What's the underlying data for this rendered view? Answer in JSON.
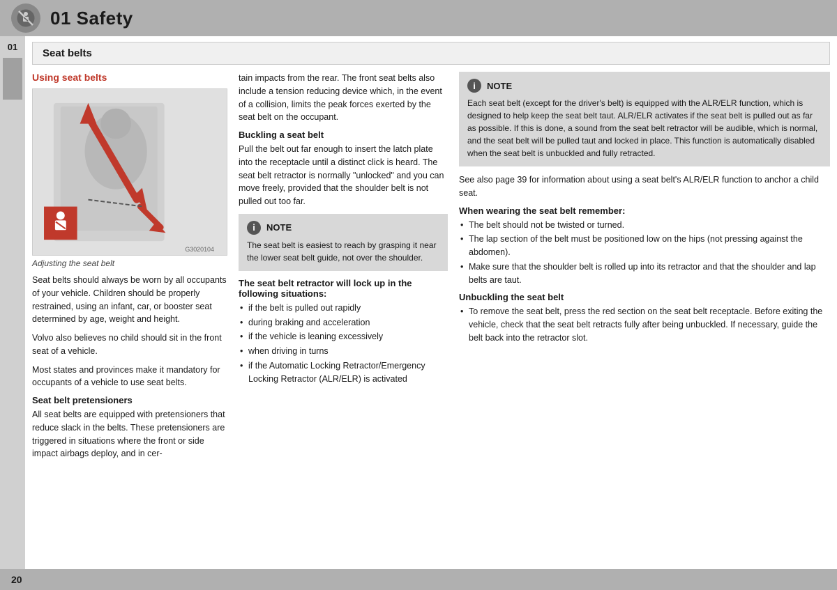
{
  "header": {
    "title": "01 Safety",
    "icon_label": "no-belt-icon"
  },
  "sidebar": {
    "number": "01"
  },
  "section": {
    "title": "Seat belts"
  },
  "left_column": {
    "section_title": "Using seat belts",
    "image_caption": "Adjusting the seat belt",
    "diagram_number": "G3020104",
    "para1": "Seat belts should always be worn by all occupants of your vehicle. Children should be properly restrained, using an infant, car, or booster seat determined by age, weight and height.",
    "para2": "Volvo also believes no child should sit in the front seat of a vehicle.",
    "para3": "Most states and provinces make it mandatory for occupants of a vehicle to use seat belts.",
    "pretensioners_title": "Seat belt pretensioners",
    "pretensioners_text": "All seat belts are equipped with pretensioners that reduce slack in the belts. These pretensioners are triggered in situations where the front or side impact airbags deploy, and in cer-"
  },
  "mid_column": {
    "continued_text": "tain impacts from the rear. The front seat belts also include a tension reducing device which, in the event of a collision, limits the peak forces exerted by the seat belt on the occupant.",
    "buckling_title": "Buckling a seat belt",
    "buckling_text": "Pull the belt out far enough to insert the latch plate into the receptacle until a distinct click is heard. The seat belt retractor is normally \"unlocked\" and you can move freely, provided that the shoulder belt is not pulled out too far.",
    "note_label": "NOTE",
    "note_text": "The seat belt is easiest to reach by grasping it near the lower seat belt guide, not over the shoulder.",
    "retractor_title": "The seat belt retractor will lock up in the following situations:",
    "retractor_bullets": [
      "if the belt is pulled out rapidly",
      "during braking and acceleration",
      "if the vehicle is leaning excessively",
      "when driving in turns",
      "if the Automatic Locking Retractor/Emergency Locking Retractor (ALR/ELR) is activated"
    ]
  },
  "right_column": {
    "note_label": "NOTE",
    "note_text": "Each seat belt (except for the driver's belt) is equipped with the ALR/ELR function, which is designed to help keep the seat belt taut. ALR/ELR activates if the seat belt is pulled out as far as possible. If this is done, a sound from the seat belt retractor will be audible, which is normal, and the seat belt will be pulled taut and locked in place. This function is automatically disabled when the seat belt is unbuckled and fully retracted.",
    "alr_text": "See also page 39 for information about using a seat belt's ALR/ELR function to anchor a child seat.",
    "when_wearing_title": "When wearing the seat belt remember:",
    "when_wearing_bullets": [
      "The belt should not be twisted or turned.",
      "The lap section of the belt must be positioned low on the hips (not pressing against the abdomen).",
      "Make sure that the shoulder belt is rolled up into its retractor and that the shoulder and lap belts are taut."
    ],
    "unbuckling_title": "Unbuckling the seat belt",
    "unbuckling_bullets": [
      "To remove the seat belt, press the red section on the seat belt receptacle. Before exiting the vehicle, check that the seat belt retracts fully after being unbuckled. If necessary, guide the belt back into the retractor slot."
    ]
  },
  "footer": {
    "page_number": "20"
  }
}
